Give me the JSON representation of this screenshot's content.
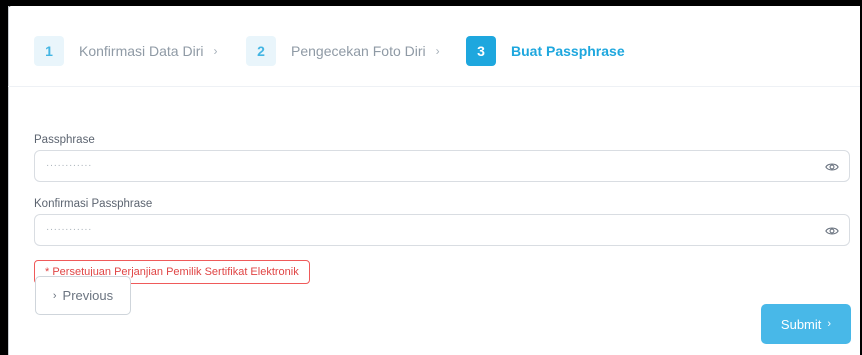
{
  "stepper": {
    "steps": [
      {
        "number": "1",
        "label": "Konfirmasi Data Diri",
        "separator": "›"
      },
      {
        "number": "2",
        "label": "Pengecekan Foto Diri",
        "separator": "›"
      },
      {
        "number": "3",
        "label": "Buat Passphrase",
        "separator": ""
      }
    ],
    "active_step": 3
  },
  "form": {
    "passphrase_label": "Passphrase",
    "passphrase_value": "············",
    "confirm_label": "Konfirmasi Passphrase",
    "confirm_value": "············",
    "agreement_text": "* Persetujuan Perjanjian Pemilik Sertifikat Elektronik"
  },
  "actions": {
    "previous_chevron": "›",
    "previous_label": "Previous",
    "submit_label": "Submit",
    "submit_chevron": "›"
  },
  "colors": {
    "accent": "#1ea7de",
    "submit": "#48b8e8",
    "error": "#e04545"
  },
  "icons": {
    "visibility": "eye-icon"
  }
}
